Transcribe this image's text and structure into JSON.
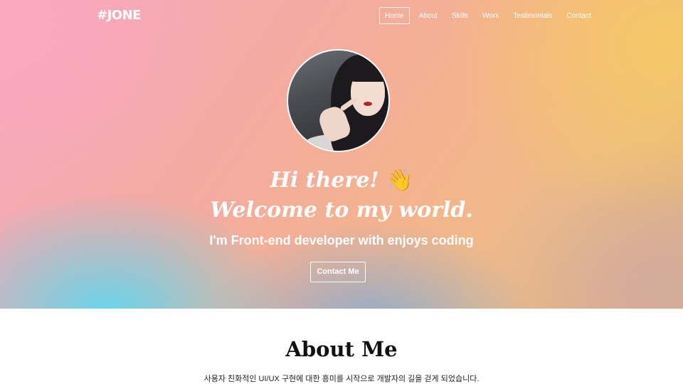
{
  "header": {
    "logo": "#JONE",
    "nav": [
      "Home",
      "About",
      "Skills",
      "Work",
      "Testimonials",
      "Contact"
    ],
    "active_nav": "Home"
  },
  "hero": {
    "greeting_line1": "Hi there!",
    "greeting_emoji": "👋",
    "greeting_line2": "Welcome to my world.",
    "subtitle": "I'm Front-end developer with enjoys coding",
    "cta_label": "Contact Me",
    "avatar_icon": "profile-photo"
  },
  "about": {
    "title": "About Me",
    "text": "사용자 친화적인 UI/UX 구현에 대한 흥미를 시작으로 개발자의 길을 걷게 되었습니다."
  },
  "colors": {
    "hero_pink": "#f8a9c0",
    "hero_orange": "#f4b38e",
    "hero_yellow": "#f5c864",
    "hero_cyan": "#5fd7f0",
    "text_dark": "#111111"
  }
}
